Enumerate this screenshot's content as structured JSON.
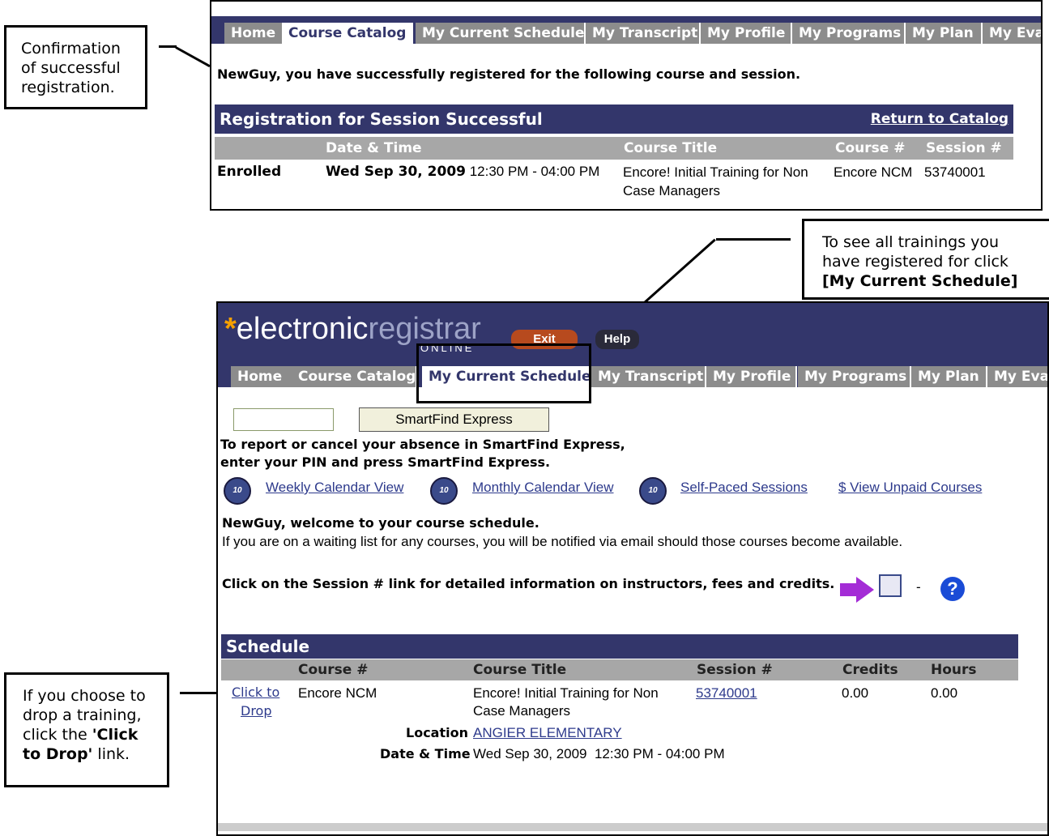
{
  "callouts": {
    "confirmation": "Confirmation of successful registration.",
    "schedule_line1": "To see all trainings you have registered for click",
    "schedule_line2": "[My Current Schedule]",
    "drop_pre": "If you choose to drop a training, click the ",
    "drop_bold": "'Click to Drop'",
    "drop_post": " link."
  },
  "top_window": {
    "tabs": [
      "Home",
      "Course Catalog",
      "My Current Schedule",
      "My Transcript",
      "My Profile",
      "My Programs",
      "My Plan",
      "My Eva"
    ],
    "active_tab": "Course Catalog",
    "message": "NewGuy, you have successfully registered for the following course and session.",
    "panel_title": "Registration for Session Successful",
    "return_link": "Return to Catalog",
    "columns": [
      "Date & Time",
      "Course Title",
      "Course #",
      "Session #"
    ],
    "row": {
      "status": "Enrolled",
      "date_bold": "Wed Sep 30, 2009",
      "time": " 12:30 PM - 04:00 PM",
      "course_title_1": "Encore! Initial Training for Non",
      "course_title_2": "Case Managers",
      "course_num": "Encore NCM",
      "session_num": "53740001"
    }
  },
  "bottom_window": {
    "logo_electronic": "electronic",
    "logo_registrar": "registrar",
    "logo_online": "ONLINE",
    "exit_label": "Exit",
    "help_label": "Help",
    "tabs": [
      "Home",
      "Course Catalog",
      "My Current Schedule",
      "My Transcript",
      "My Profile",
      "My Programs",
      "My Plan",
      "My Eva"
    ],
    "active_tab": "My Current Schedule",
    "pin_input_value": "",
    "smartfind_button": "SmartFind Express",
    "smartfind_text_1": "To report or cancel your absence in SmartFind Express,",
    "smartfind_text_2": "enter your PIN and press SmartFind Express.",
    "links": [
      "Weekly Calendar View",
      "Monthly Calendar View",
      "Self-Paced Sessions",
      "$ View Unpaid Courses"
    ],
    "welcome": "NewGuy, welcome to your course schedule.",
    "waiting_note": "If you are on a waiting list for any courses, you will be notified via email should those courses become available.",
    "session_hint": "Click on the Session # link for detailed information on instructors, fees and credits.",
    "hint_dash": "-",
    "schedule_title": "Schedule",
    "columns": [
      "Course #",
      "Course Title",
      "Session #",
      "Credits",
      "Hours"
    ],
    "row": {
      "drop_line1": "Click to",
      "drop_line2": "Drop",
      "course_num": "Encore NCM",
      "course_title_1": "Encore! Initial Training for Non",
      "course_title_2": "Case Managers",
      "session_num": "53740001",
      "credits": "0.00",
      "hours": "0.00",
      "location_label": "Location",
      "location_value": "ANGIER ELEMENTARY",
      "datetime_label": "Date & Time",
      "datetime_value": "Wed Sep 30, 2009  12:30 PM - 04:00 PM"
    }
  },
  "colors": {
    "nav_bg": "#33366b",
    "tab_bg": "#8c8c8c",
    "header_bg": "#33366b",
    "col_header_bg": "#a7a7a7",
    "link": "#2d3a8c",
    "logo_star": "#f5a000"
  }
}
